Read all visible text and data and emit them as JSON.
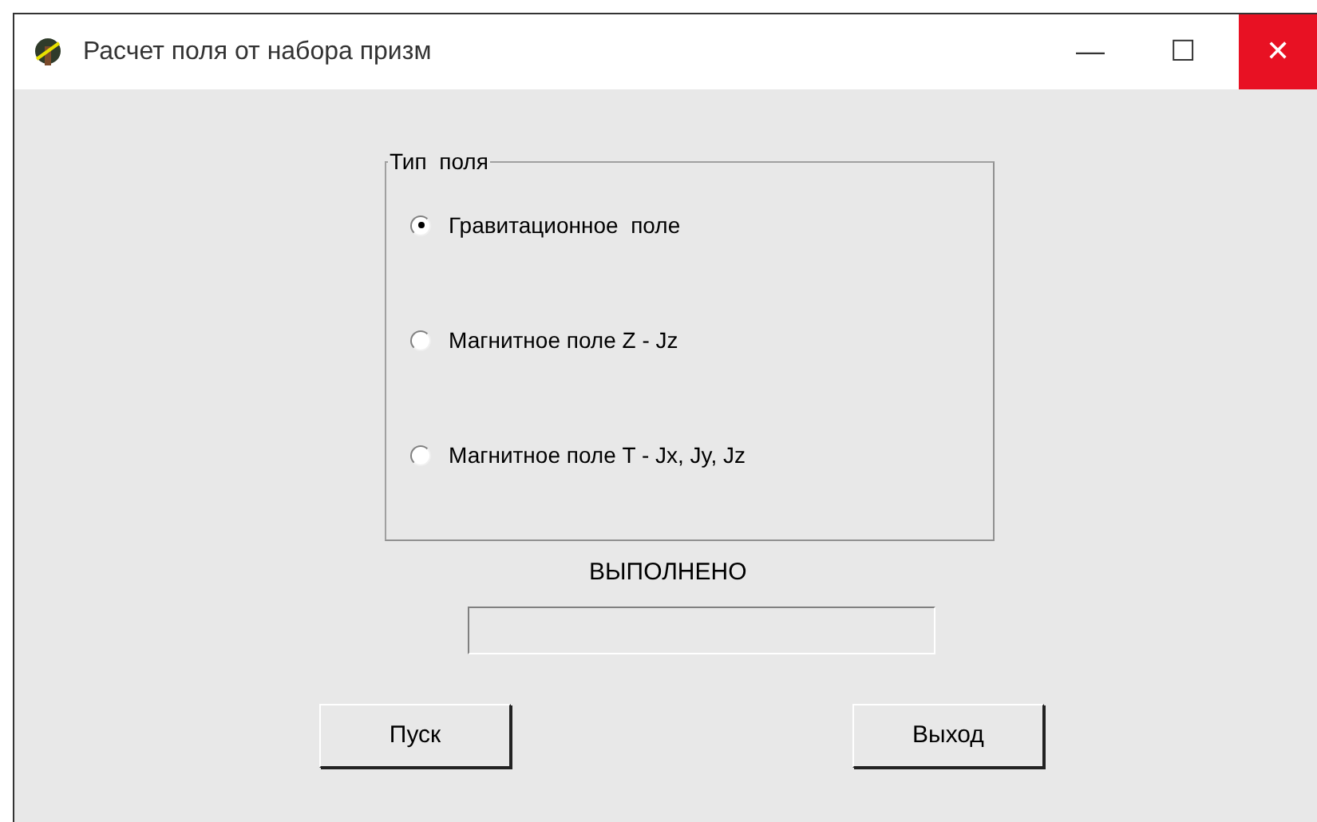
{
  "window": {
    "title": "Расчет поля от набора призм",
    "controls": [
      "—",
      "☐",
      "✕"
    ]
  },
  "field_type": {
    "legend": "Тип  поля",
    "options": [
      {
        "label": "Гравитационное  поле",
        "selected": true
      },
      {
        "label": "Магнитное поле Z - Jz",
        "selected": false
      },
      {
        "label": "Магнитное поле T - Jx, Jy, Jz",
        "selected": false
      }
    ]
  },
  "status": {
    "label": "ВЫПОЛНЕНО",
    "level": 0
  },
  "buttons": [
    "Пуск",
    "Выход"
  ]
}
